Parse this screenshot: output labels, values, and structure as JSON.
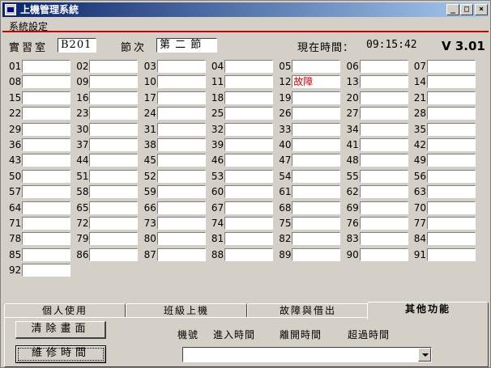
{
  "window": {
    "title": "上機管理系統",
    "minimize_glyph": "_",
    "maximize_glyph": "□",
    "close_glyph": "×"
  },
  "menu": {
    "items": [
      "系統設定"
    ]
  },
  "header": {
    "room_label": "實習室",
    "room_value": "B201",
    "period_label": "節次",
    "period_value": "第 二 節",
    "time_label": "現在時間：",
    "time_value": "09:15:42",
    "version": "V 3.01"
  },
  "seats": [
    {
      "num": "01",
      "status": ""
    },
    {
      "num": "02",
      "status": ""
    },
    {
      "num": "03",
      "status": ""
    },
    {
      "num": "04",
      "status": ""
    },
    {
      "num": "05",
      "status": ""
    },
    {
      "num": "06",
      "status": ""
    },
    {
      "num": "07",
      "status": ""
    },
    {
      "num": "08",
      "status": ""
    },
    {
      "num": "09",
      "status": ""
    },
    {
      "num": "10",
      "status": ""
    },
    {
      "num": "11",
      "status": ""
    },
    {
      "num": "12",
      "status": "故障"
    },
    {
      "num": "13",
      "status": ""
    },
    {
      "num": "14",
      "status": ""
    },
    {
      "num": "15",
      "status": ""
    },
    {
      "num": "16",
      "status": ""
    },
    {
      "num": "17",
      "status": ""
    },
    {
      "num": "18",
      "status": ""
    },
    {
      "num": "19",
      "status": ""
    },
    {
      "num": "20",
      "status": ""
    },
    {
      "num": "21",
      "status": ""
    },
    {
      "num": "22",
      "status": ""
    },
    {
      "num": "23",
      "status": ""
    },
    {
      "num": "24",
      "status": ""
    },
    {
      "num": "25",
      "status": ""
    },
    {
      "num": "26",
      "status": ""
    },
    {
      "num": "27",
      "status": ""
    },
    {
      "num": "28",
      "status": ""
    },
    {
      "num": "29",
      "status": ""
    },
    {
      "num": "30",
      "status": ""
    },
    {
      "num": "31",
      "status": ""
    },
    {
      "num": "32",
      "status": ""
    },
    {
      "num": "33",
      "status": ""
    },
    {
      "num": "34",
      "status": ""
    },
    {
      "num": "35",
      "status": ""
    },
    {
      "num": "36",
      "status": ""
    },
    {
      "num": "37",
      "status": ""
    },
    {
      "num": "38",
      "status": ""
    },
    {
      "num": "39",
      "status": ""
    },
    {
      "num": "40",
      "status": ""
    },
    {
      "num": "41",
      "status": ""
    },
    {
      "num": "42",
      "status": ""
    },
    {
      "num": "43",
      "status": ""
    },
    {
      "num": "44",
      "status": ""
    },
    {
      "num": "45",
      "status": ""
    },
    {
      "num": "46",
      "status": ""
    },
    {
      "num": "47",
      "status": ""
    },
    {
      "num": "48",
      "status": ""
    },
    {
      "num": "49",
      "status": ""
    },
    {
      "num": "50",
      "status": ""
    },
    {
      "num": "51",
      "status": ""
    },
    {
      "num": "52",
      "status": ""
    },
    {
      "num": "53",
      "status": ""
    },
    {
      "num": "54",
      "status": ""
    },
    {
      "num": "55",
      "status": ""
    },
    {
      "num": "56",
      "status": ""
    },
    {
      "num": "57",
      "status": ""
    },
    {
      "num": "58",
      "status": ""
    },
    {
      "num": "59",
      "status": ""
    },
    {
      "num": "60",
      "status": ""
    },
    {
      "num": "61",
      "status": ""
    },
    {
      "num": "62",
      "status": ""
    },
    {
      "num": "63",
      "status": ""
    },
    {
      "num": "64",
      "status": ""
    },
    {
      "num": "65",
      "status": ""
    },
    {
      "num": "66",
      "status": ""
    },
    {
      "num": "67",
      "status": ""
    },
    {
      "num": "68",
      "status": ""
    },
    {
      "num": "69",
      "status": ""
    },
    {
      "num": "70",
      "status": ""
    },
    {
      "num": "71",
      "status": ""
    },
    {
      "num": "72",
      "status": ""
    },
    {
      "num": "73",
      "status": ""
    },
    {
      "num": "74",
      "status": ""
    },
    {
      "num": "75",
      "status": ""
    },
    {
      "num": "76",
      "status": ""
    },
    {
      "num": "77",
      "status": ""
    },
    {
      "num": "78",
      "status": ""
    },
    {
      "num": "79",
      "status": ""
    },
    {
      "num": "80",
      "status": ""
    },
    {
      "num": "81",
      "status": ""
    },
    {
      "num": "82",
      "status": ""
    },
    {
      "num": "83",
      "status": ""
    },
    {
      "num": "84",
      "status": ""
    },
    {
      "num": "85",
      "status": ""
    },
    {
      "num": "86",
      "status": ""
    },
    {
      "num": "87",
      "status": ""
    },
    {
      "num": "88",
      "status": ""
    },
    {
      "num": "89",
      "status": ""
    },
    {
      "num": "90",
      "status": ""
    },
    {
      "num": "91",
      "status": ""
    },
    {
      "num": "92",
      "status": ""
    }
  ],
  "tabs": [
    {
      "label": "個人使用",
      "active": false
    },
    {
      "label": "班級上機",
      "active": false
    },
    {
      "label": "故障與借出",
      "active": false
    },
    {
      "label": "其他功能",
      "active": true
    }
  ],
  "panel": {
    "clear_button": "清除畫面",
    "repair_button": "維修時間",
    "columns": [
      "機號",
      "進入時間",
      "離開時間",
      "超過時間"
    ],
    "combo_value": ""
  },
  "colors": {
    "title_start": "#0a246a",
    "title_end": "#a6caf0",
    "fault_text": "#d00000",
    "menu_rule": "#c00000"
  }
}
